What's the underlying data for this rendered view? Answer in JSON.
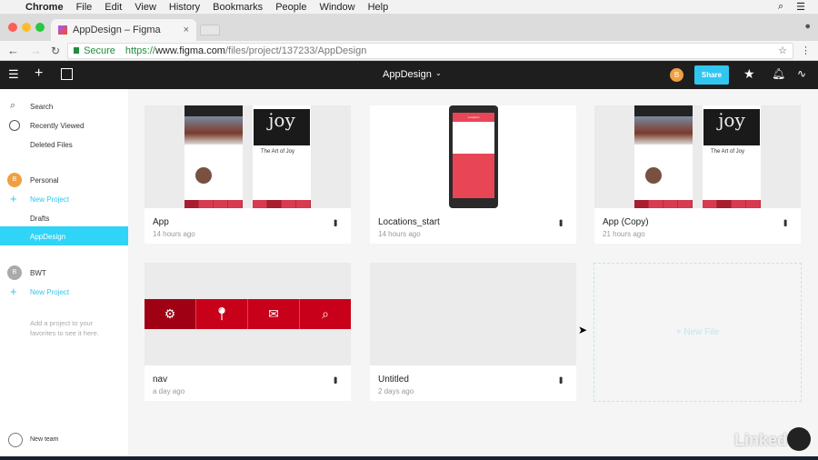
{
  "menubar": {
    "items": [
      "Chrome",
      "File",
      "Edit",
      "View",
      "History",
      "Bookmarks",
      "People",
      "Window",
      "Help"
    ]
  },
  "browser": {
    "tab_title": "AppDesign – Figma",
    "secure_label": "Secure",
    "url_scheme": "https://",
    "url_host": "www.figma.com",
    "url_path": "/files/project/137233/AppDesign"
  },
  "toolbar": {
    "title": "AppDesign",
    "avatar_letter": "B",
    "share_label": "Share",
    "accent": "#30c6ef"
  },
  "sidebar": {
    "search": "Search",
    "recent": "Recently Viewed",
    "deleted": "Deleted Files",
    "personal": {
      "avatar": "B",
      "name": "Personal",
      "new_project": "New Project",
      "drafts": "Drafts",
      "active": "AppDesign"
    },
    "team": {
      "avatar": "B",
      "name": "BWT",
      "new_project": "New Project",
      "hint": "Add a project to your favorites to see it here."
    },
    "new_team": "New team"
  },
  "files": [
    {
      "name": "App",
      "time": "14 hours ago"
    },
    {
      "name": "Locations_start",
      "time": "14 hours ago",
      "phone_header": "Locations"
    },
    {
      "name": "App (Copy)",
      "time": "21 hours ago"
    },
    {
      "name": "nav",
      "time": "a day ago"
    },
    {
      "name": "Untitled",
      "time": "2 days ago"
    }
  ],
  "thumbs": {
    "joy_title": "The Art of Joy",
    "joy_word": "joy"
  },
  "new_file": "+ New File",
  "watermark": "Linked in"
}
